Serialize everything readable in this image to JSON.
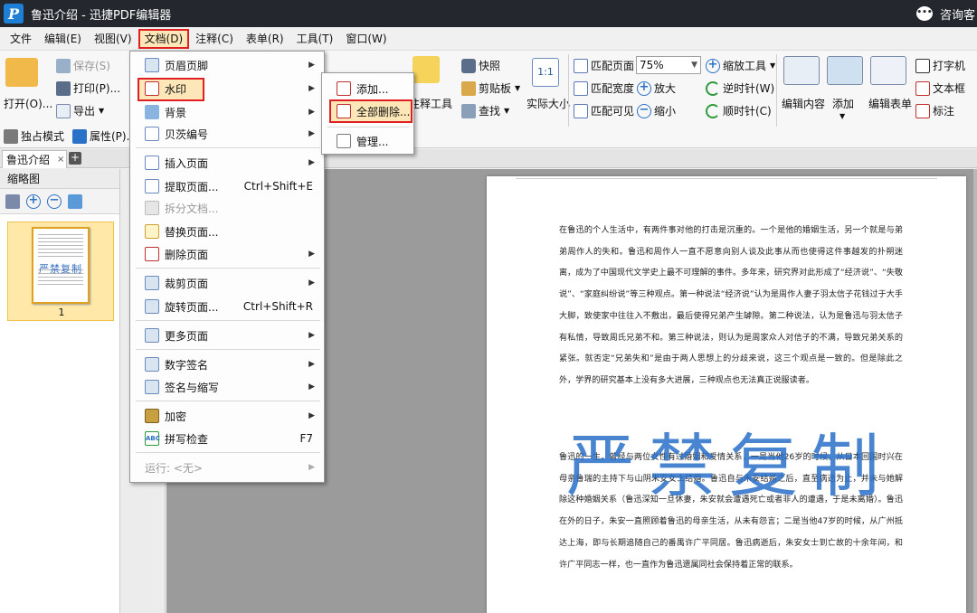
{
  "window": {
    "title": "鲁迅介绍 - 迅捷PDF编辑器",
    "logo": "P",
    "consult_label": "咨询客"
  },
  "menubar": {
    "items": [
      "文件",
      "编辑(E)",
      "视图(V)",
      "文档(D)",
      "注释(C)",
      "表单(R)",
      "工具(T)",
      "窗口(W)"
    ],
    "active": "文档(D)"
  },
  "ribbon": {
    "open_label": "打开(O)...",
    "save_label": "保存(S)",
    "print_label": "打印(P)...",
    "export_label": "导出",
    "exclusive_mode_label": "独占模式",
    "properties_label": "属性(P)...",
    "annotate_tool_label": "注释工具",
    "snapshot_label": "快照",
    "clipboard_label": "剪贴板",
    "find_label": "查找",
    "actual_size_label": "实际大小",
    "actual_size_icon_text": "1:1",
    "fit_page_label": "匹配页面",
    "fit_width_label": "匹配宽度",
    "fit_visible_label": "匹配可见",
    "zoom_value": "75%",
    "zoom_tool_label": "缩放工具",
    "zoom_in_label": "放大",
    "zoom_out_label": "缩小",
    "rotate_ccw_label": "逆时针(W)",
    "rotate_cw_label": "顺时针(C)",
    "edit_content_label": "编辑内容",
    "add_label": "添加",
    "edit_form_label": "编辑表单",
    "typewriter_label": "打字机",
    "textbox_label": "文本框",
    "callout_label": "标注"
  },
  "tabs": {
    "doc_tab": "鲁迅介绍",
    "close": "×",
    "add": "+"
  },
  "leftpanel": {
    "title": "缩略图",
    "page_number": "1",
    "thumb_watermark": "严禁复制"
  },
  "document": {
    "watermark": "严禁复制",
    "paragraphs": [
      "在鲁迅的个人生活中，有两件事对他的打击是沉重的。一个是他的婚姻生活，另一个就是与弟弟周作人的失和。鲁迅和周作人一直不愿意向别人谈及此事从而也使得这件事越发的扑朔迷离，成为了中国现代文学史上最不可理解的事件。多年来，研究界对此形成了“经济说”、“失敬说”、“家庭纠纷说”等三种观点。第一种说法“经济说”认为是周作人妻子羽太信子花钱过于大手大脚，致使家中往往入不敷出，最后使得兄弟产生罅隙。第二种说法，认为是鲁迅与羽太信子有私情，导致周氏兄弟不和。第三种说法，则认为是周家众人对信子的不满，导致兄弟关系的紧张。就否定“兄弟失和”是由于两人思想上的分歧来说，这三个观点是一致的。但是除此之外，学界的研究基本上没有多大进展，三种观点也无法真正说服读者。",
      "鲁迅的一生，曾经与两位女性有过婚姻和爱情关系，一是当他26岁的时候，从日本回国时兴在母亲鲁瑞的主持下与山阴朱安女士结婚。鲁迅自与朱安结婚之后，直至病逝为止，并未与她解除这种婚姻关系（鲁迅深知一旦休妻，朱安就会遭遇死亡或者非人的遭遇，于是未离婚）。鲁迅在外的日子，朱安一直照顾着鲁迅的母亲生活，从未有怨言；二是当他47岁的时候，从广州抵达上海，即与长期追随自己的番禺许广平同居。鲁迅病逝后，朱安女士到亡故的十余年间，和许广平同志一样，也一直作为鲁迅遗属同社会保持着正常的联系。"
    ]
  },
  "doc_menu": {
    "items": [
      {
        "label": "页眉页脚",
        "shortcut": "",
        "submenu": true,
        "disabled": false
      },
      {
        "label": "水印",
        "shortcut": "",
        "submenu": true,
        "disabled": false
      },
      {
        "label": "背景",
        "shortcut": "",
        "submenu": true,
        "disabled": false
      },
      {
        "label": "贝茨编号",
        "shortcut": "",
        "submenu": true,
        "disabled": false
      },
      {
        "label": "插入页面",
        "shortcut": "",
        "submenu": true,
        "disabled": false
      },
      {
        "label": "提取页面...",
        "shortcut": "Ctrl+Shift+E",
        "submenu": false,
        "disabled": false
      },
      {
        "label": "拆分文档...",
        "shortcut": "",
        "submenu": false,
        "disabled": true
      },
      {
        "label": "替换页面...",
        "shortcut": "",
        "submenu": false,
        "disabled": false
      },
      {
        "label": "删除页面",
        "shortcut": "",
        "submenu": true,
        "disabled": false
      },
      {
        "label": "裁剪页面",
        "shortcut": "",
        "submenu": true,
        "disabled": false
      },
      {
        "label": "旋转页面...",
        "shortcut": "Ctrl+Shift+R",
        "submenu": false,
        "disabled": false
      },
      {
        "label": "更多页面",
        "shortcut": "",
        "submenu": true,
        "disabled": false
      },
      {
        "label": "数字签名",
        "shortcut": "",
        "submenu": true,
        "disabled": false
      },
      {
        "label": "签名与缩写",
        "shortcut": "",
        "submenu": true,
        "disabled": false
      },
      {
        "label": "加密",
        "shortcut": "",
        "submenu": true,
        "disabled": false
      },
      {
        "label": "拼写检查",
        "shortcut": "F7",
        "submenu": false,
        "disabled": false
      },
      {
        "label": "运行: <无>",
        "shortcut": "",
        "submenu": true,
        "disabled": true
      }
    ]
  },
  "watermark_submenu": {
    "items": [
      "添加...",
      "全部删除...",
      "管理..."
    ],
    "highlighted": "全部删除..."
  },
  "colors": {
    "titlebar": "#24282e",
    "highlight_border": "#e02020",
    "highlight_fill": "#fde7b8",
    "watermark": "#286ec8"
  }
}
